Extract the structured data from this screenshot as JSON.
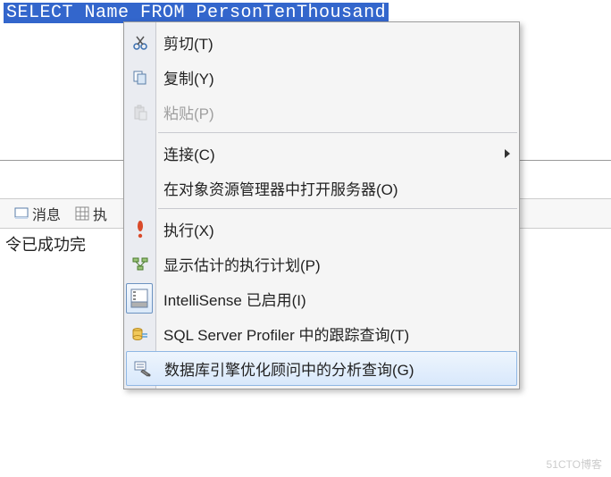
{
  "editor": {
    "sql": "SELECT Name FROM PersonTenThousand"
  },
  "results": {
    "tab_messages": "消息",
    "tab_other_partial": "执",
    "body_text": "令已成功完"
  },
  "context_menu": {
    "items": [
      {
        "label": "剪切(T)",
        "icon": "cut-icon",
        "enabled": true,
        "sep": false,
        "arrow": false
      },
      {
        "label": "复制(Y)",
        "icon": "copy-icon",
        "enabled": true,
        "sep": false,
        "arrow": false
      },
      {
        "label": "粘贴(P)",
        "icon": "paste-icon",
        "enabled": false,
        "sep": true,
        "arrow": false
      },
      {
        "label": "连接(C)",
        "icon": "",
        "enabled": true,
        "sep": false,
        "arrow": true
      },
      {
        "label": "在对象资源管理器中打开服务器(O)",
        "icon": "",
        "enabled": true,
        "sep": true,
        "arrow": false
      },
      {
        "label": "执行(X)",
        "icon": "exclaim-icon",
        "enabled": true,
        "sep": false,
        "arrow": false
      },
      {
        "label": "显示估计的执行计划(P)",
        "icon": "plan-icon",
        "enabled": true,
        "sep": false,
        "arrow": false
      },
      {
        "label": "IntelliSense 已启用(I)",
        "icon": "intellisense-icon",
        "enabled": true,
        "sep": false,
        "arrow": false
      },
      {
        "label": "SQL Server Profiler 中的跟踪查询(T)",
        "icon": "profiler-icon",
        "enabled": true,
        "sep": false,
        "arrow": false
      },
      {
        "label": "数据库引擎优化顾问中的分析查询(G)",
        "icon": "tuning-icon",
        "enabled": true,
        "sep": false,
        "arrow": false,
        "highlight": true
      }
    ]
  },
  "watermark": "51CTO博客"
}
